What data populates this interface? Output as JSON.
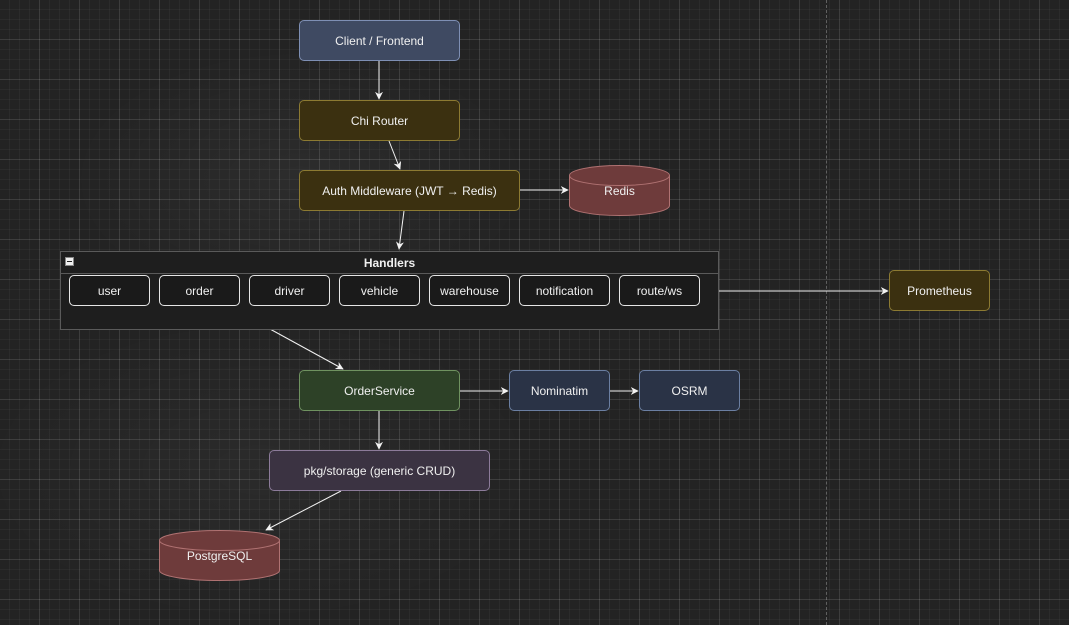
{
  "nodes": {
    "client": "Client / Frontend",
    "router": "Chi Router",
    "auth": "Auth Middleware (JWT → Redis)",
    "redis": "Redis",
    "prometheus": "Prometheus",
    "order_service": "OrderService",
    "nominatim": "Nominatim",
    "osrm": "OSRM",
    "storage": "pkg/storage (generic CRUD)",
    "postgres": "PostgreSQL"
  },
  "handlers": {
    "title": "Handlers",
    "items": [
      "user",
      "order",
      "driver",
      "vehicle",
      "warehouse",
      "notification",
      "route/ws"
    ]
  },
  "colors": {
    "client": "#3f4a62",
    "router": "#3b3010",
    "auth": "#3b3010",
    "prometheus": "#3b3010",
    "order_service": "#2d4127",
    "external_api": "#2a3346",
    "storage": "#3b3342",
    "database": "#6e3b3b",
    "edge": "#f2f2f2"
  }
}
